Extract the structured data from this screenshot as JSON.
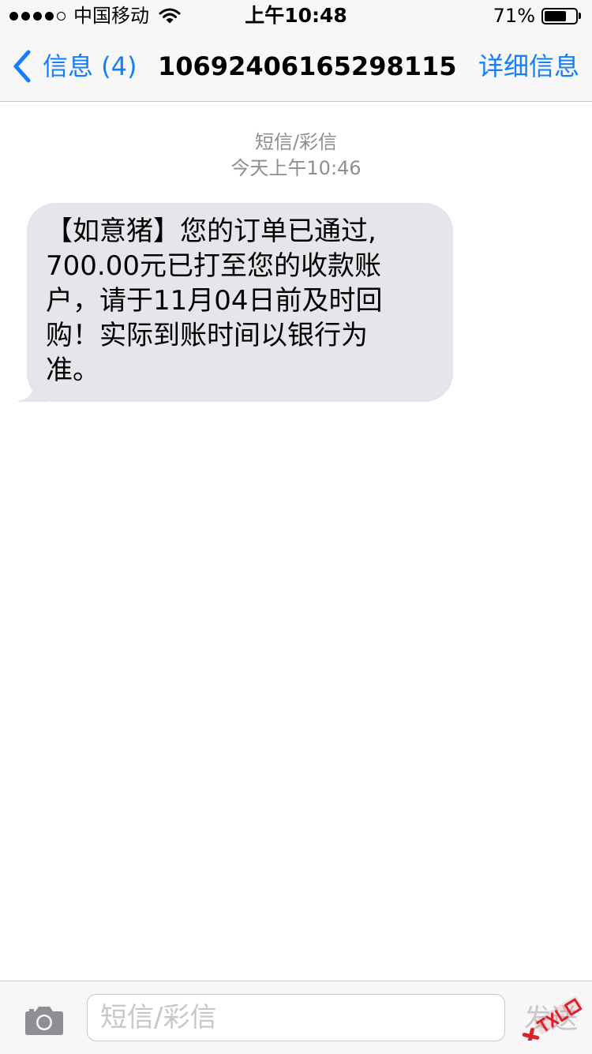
{
  "status_bar": {
    "carrier": "中国移动",
    "time": "上午10:48",
    "battery_percent_label": "71%",
    "battery_level": 0.71,
    "signal_bars_filled": 4,
    "signal_bars_total": 5
  },
  "nav": {
    "back_label": "信息 (4)",
    "title": "10692406165298115",
    "details_label": "详细信息"
  },
  "conversation": {
    "type_label": "短信/彩信",
    "timestamp": "今天上午10:46",
    "messages": [
      {
        "direction": "incoming",
        "lines": [
          "【如意猪】您的订单已通过,",
          "700.00元已打至您的收款账",
          "户，请于11月04日前及时回",
          "购！实际到账时间以银行为",
          "准。"
        ]
      }
    ]
  },
  "input_bar": {
    "placeholder": "短信/彩信",
    "value": "",
    "send_label": "发送"
  },
  "colors": {
    "accent": "#147efb",
    "bubble_incoming": "#e5e5ea",
    "bar_background": "#f7f7f8",
    "secondary_text": "#8e8e93",
    "placeholder_text": "#c7c7cc"
  },
  "icons": {
    "back": "chevron-left-icon",
    "camera": "camera-icon",
    "wifi": "wifi-icon",
    "battery": "battery-icon",
    "watermark": "watermark-logo"
  }
}
